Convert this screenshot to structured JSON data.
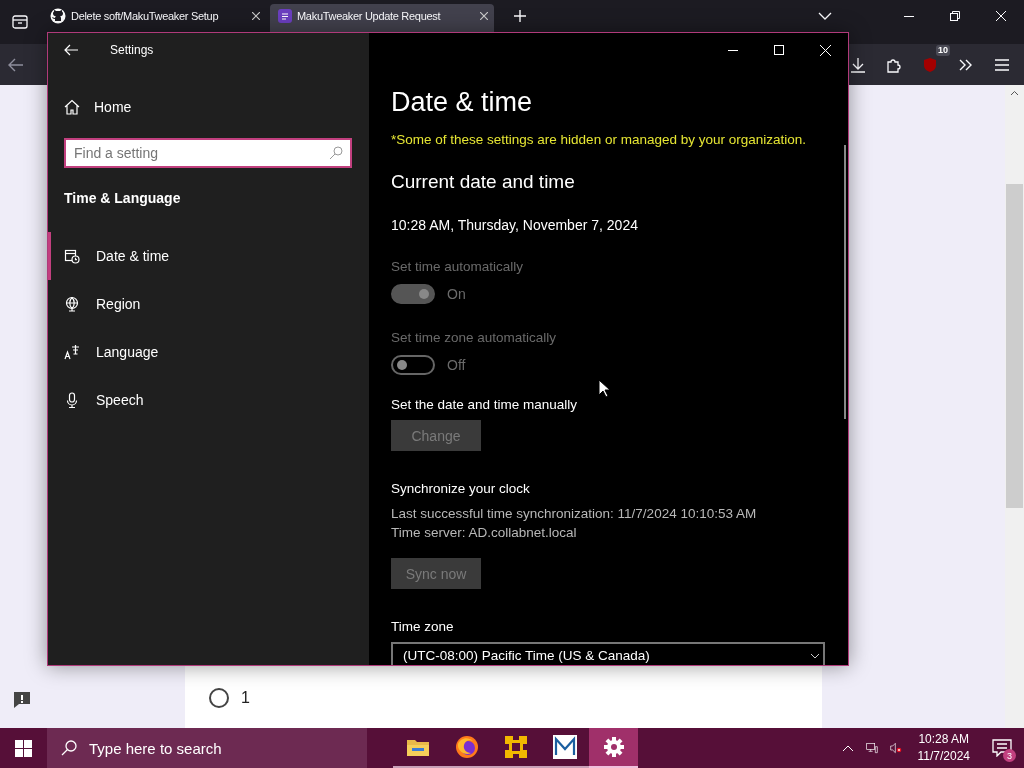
{
  "browser": {
    "tabs": [
      {
        "title": "Delete soft/MakuTweaker Setup",
        "selected": false
      },
      {
        "title": "MakuTweaker Update Request",
        "selected": true
      }
    ],
    "extension_badge": "10",
    "form_option": "1"
  },
  "settings": {
    "title": "Settings",
    "home": "Home",
    "search": {
      "placeholder": "Find a setting"
    },
    "section": "Time & Language",
    "nav": [
      {
        "label": "Date & time",
        "kind": "calendar",
        "selected": true
      },
      {
        "label": "Region",
        "kind": "globe",
        "selected": false
      },
      {
        "label": "Language",
        "kind": "language",
        "selected": false
      },
      {
        "label": "Speech",
        "kind": "microphone",
        "selected": false
      }
    ],
    "page_title": "Date & time",
    "notice": "*Some of these settings are hidden or managed by your organization.",
    "current_heading": "Current date and time",
    "current_time": "10:28 AM, Thursday, November 7, 2024",
    "toggles": [
      {
        "label": "Set time automatically",
        "state_text": "On",
        "on": true,
        "disabled": true
      },
      {
        "label": "Set time zone automatically",
        "state_text": "Off",
        "on": false,
        "disabled": true
      }
    ],
    "manual_label": "Set the date and time manually",
    "change_button": {
      "label": "Change",
      "disabled": true
    },
    "sync_heading": "Synchronize your clock",
    "sync_lines": [
      "Last successful time synchronization: 11/7/2024 10:10:53 AM",
      "Time server: AD.collabnet.local"
    ],
    "sync_button": {
      "label": "Sync now",
      "disabled": true
    },
    "time_zone_label": "Time zone",
    "time_zone": "(UTC-08:00) Pacific Time (US & Canada)"
  },
  "taskbar": {
    "search_placeholder": "Type here to search",
    "apps": [
      {
        "kind": "folder",
        "selected": false
      },
      {
        "kind": "firefox",
        "selected": false
      },
      {
        "kind": "tweaker",
        "selected": false
      },
      {
        "kind": "maku",
        "selected": false
      },
      {
        "kind": "settings",
        "selected": true
      }
    ],
    "time": "10:28 AM",
    "date": "11/7/2024",
    "notification_count": "3"
  }
}
